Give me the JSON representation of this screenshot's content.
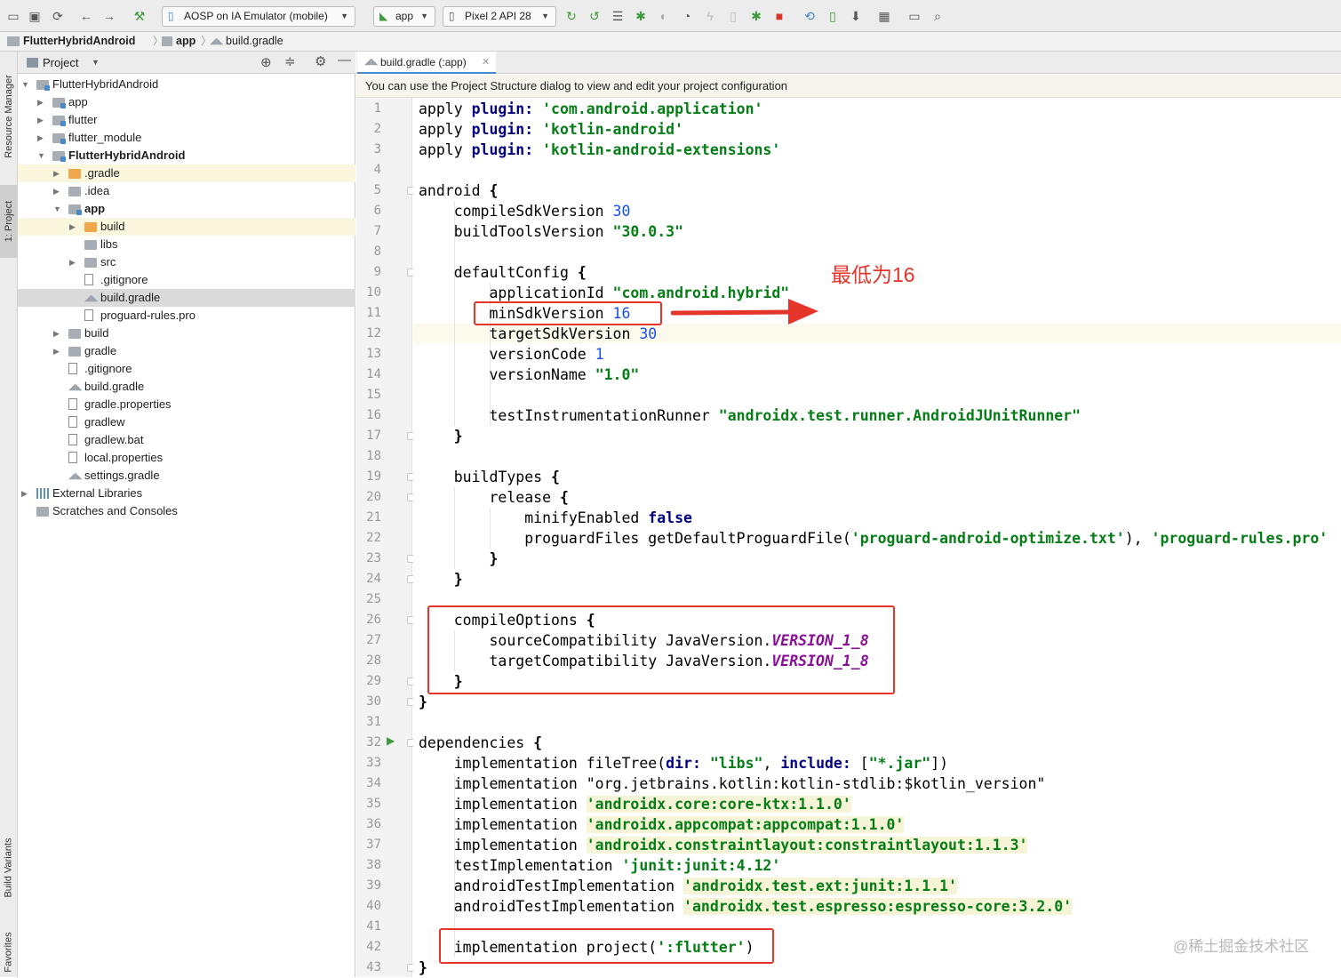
{
  "toolbar": {
    "config_label": "AOSP on IA Emulator (mobile)",
    "module_label": "app",
    "device_label": "Pixel 2 API 28"
  },
  "breadcrumb": [
    "FlutterHybridAndroid",
    "app",
    "build.gradle"
  ],
  "side_tabs": {
    "resource_manager": "Resource Manager",
    "project": "1: Project",
    "build_variants": "Build Variants",
    "favorites": "Favorites"
  },
  "project_panel": {
    "title": "Project",
    "tree": [
      {
        "label": "FlutterHybridAndroid",
        "depth": 0,
        "icon": "folder-mod",
        "expanded": true,
        "bold": false
      },
      {
        "label": "app",
        "depth": 1,
        "icon": "folder-mod",
        "expanded": false,
        "bold": false
      },
      {
        "label": "flutter",
        "depth": 1,
        "icon": "folder-mod",
        "expanded": false,
        "bold": false
      },
      {
        "label": "flutter_module",
        "depth": 1,
        "icon": "folder-mod",
        "expanded": false,
        "bold": false
      },
      {
        "label": "FlutterHybridAndroid",
        "depth": 1,
        "icon": "folder-mod",
        "expanded": true,
        "bold": true
      },
      {
        "label": ".gradle",
        "depth": 2,
        "icon": "folder-orange",
        "expanded": false,
        "bold": false,
        "highlight": "yellow"
      },
      {
        "label": ".idea",
        "depth": 2,
        "icon": "folder",
        "expanded": false,
        "bold": false
      },
      {
        "label": "app",
        "depth": 2,
        "icon": "folder-mod",
        "expanded": true,
        "bold": true
      },
      {
        "label": "build",
        "depth": 3,
        "icon": "folder-orange",
        "expanded": false,
        "bold": false,
        "highlight": "yellow"
      },
      {
        "label": "libs",
        "depth": 3,
        "icon": "folder",
        "leaf": true,
        "bold": false
      },
      {
        "label": "src",
        "depth": 3,
        "icon": "folder",
        "expanded": false,
        "bold": false
      },
      {
        "label": ".gitignore",
        "depth": 3,
        "icon": "file",
        "leaf": true,
        "bold": false
      },
      {
        "label": "build.gradle",
        "depth": 3,
        "icon": "gradle",
        "leaf": true,
        "bold": false,
        "highlight": "selected"
      },
      {
        "label": "proguard-rules.pro",
        "depth": 3,
        "icon": "file",
        "leaf": true,
        "bold": false
      },
      {
        "label": "build",
        "depth": 2,
        "icon": "folder",
        "expanded": false,
        "bold": false
      },
      {
        "label": "gradle",
        "depth": 2,
        "icon": "folder",
        "expanded": false,
        "bold": false
      },
      {
        "label": ".gitignore",
        "depth": 2,
        "icon": "file",
        "leaf": true,
        "bold": false
      },
      {
        "label": "build.gradle",
        "depth": 2,
        "icon": "gradle",
        "leaf": true,
        "bold": false
      },
      {
        "label": "gradle.properties",
        "depth": 2,
        "icon": "file",
        "leaf": true,
        "bold": false
      },
      {
        "label": "gradlew",
        "depth": 2,
        "icon": "file",
        "leaf": true,
        "bold": false
      },
      {
        "label": "gradlew.bat",
        "depth": 2,
        "icon": "file",
        "leaf": true,
        "bold": false
      },
      {
        "label": "local.properties",
        "depth": 2,
        "icon": "file",
        "leaf": true,
        "bold": false
      },
      {
        "label": "settings.gradle",
        "depth": 2,
        "icon": "gradle",
        "leaf": true,
        "bold": false
      },
      {
        "label": "External Libraries",
        "depth": 0,
        "icon": "lib",
        "expanded": false,
        "bold": false
      },
      {
        "label": "Scratches and Consoles",
        "depth": 0,
        "icon": "folder",
        "leaf": true,
        "bold": false
      }
    ]
  },
  "editor": {
    "tab_label": "build.gradle (:app)",
    "notice": "You can use the Project Structure dialog to view and edit your project configuration",
    "lines": [
      [
        [
          "apply ",
          ""
        ],
        [
          "plugin:",
          "kw"
        ],
        [
          " 'com.android.application'",
          "str"
        ]
      ],
      [
        [
          "apply ",
          ""
        ],
        [
          "plugin:",
          "kw"
        ],
        [
          " 'kotlin-android'",
          "str"
        ]
      ],
      [
        [
          "apply ",
          ""
        ],
        [
          "plugin:",
          "kw"
        ],
        [
          " 'kotlin-android-extensions'",
          "str"
        ]
      ],
      [],
      [
        [
          "android ",
          ""
        ],
        [
          "{",
          "bold"
        ]
      ],
      [
        [
          "    compileSdkVersion ",
          ""
        ],
        [
          "30",
          "num"
        ]
      ],
      [
        [
          "    buildToolsVersion ",
          ""
        ],
        [
          "\"30.0.3\"",
          "str"
        ]
      ],
      [],
      [
        [
          "    defaultConfig ",
          ""
        ],
        [
          "{",
          "bold"
        ]
      ],
      [
        [
          "        applicationId ",
          ""
        ],
        [
          "\"com.android.hybrid\"",
          "str"
        ]
      ],
      [
        [
          "        minSdkVersion ",
          ""
        ],
        [
          "16",
          "num"
        ]
      ],
      [
        [
          "        targetSdkVersion ",
          ""
        ],
        [
          "30",
          "num"
        ]
      ],
      [
        [
          "        versionCode ",
          ""
        ],
        [
          "1",
          "num"
        ]
      ],
      [
        [
          "        versionName ",
          ""
        ],
        [
          "\"1.0\"",
          "str"
        ]
      ],
      [],
      [
        [
          "        testInstrumentationRunner ",
          ""
        ],
        [
          "\"androidx.test.runner.AndroidJUnitRunner\"",
          "str"
        ]
      ],
      [
        [
          "    ",
          ""
        ],
        [
          "}",
          "bold"
        ]
      ],
      [],
      [
        [
          "    buildTypes ",
          ""
        ],
        [
          "{",
          "bold"
        ]
      ],
      [
        [
          "        release ",
          ""
        ],
        [
          "{",
          "bold"
        ]
      ],
      [
        [
          "            minifyEnabled ",
          ""
        ],
        [
          "false",
          "kw"
        ]
      ],
      [
        [
          "            proguardFiles getDefaultProguardFile(",
          ""
        ],
        [
          "'proguard-android-optimize.txt'",
          "str"
        ],
        [
          "), ",
          ""
        ],
        [
          "'proguard-rules.pro'",
          "str"
        ]
      ],
      [
        [
          "        ",
          ""
        ],
        [
          "}",
          "bold"
        ]
      ],
      [
        [
          "    ",
          ""
        ],
        [
          "}",
          "bold"
        ]
      ],
      [],
      [
        [
          "    compileOptions ",
          ""
        ],
        [
          "{",
          "bold"
        ]
      ],
      [
        [
          "        sourceCompatibility JavaVersion.",
          ""
        ],
        [
          "VERSION_1_8",
          "ital"
        ]
      ],
      [
        [
          "        targetCompatibility JavaVersion.",
          ""
        ],
        [
          "VERSION_1_8",
          "ital"
        ]
      ],
      [
        [
          "    ",
          ""
        ],
        [
          "}",
          "bold"
        ]
      ],
      [
        [
          "}",
          "bold"
        ]
      ],
      [],
      [
        [
          "dependencies ",
          ""
        ],
        [
          "{",
          "bold"
        ]
      ],
      [
        [
          "    implementation fileTree(",
          ""
        ],
        [
          "dir:",
          "kw"
        ],
        [
          " ",
          ""
        ],
        [
          "\"libs\"",
          "str"
        ],
        [
          ", ",
          ""
        ],
        [
          "include:",
          "kw"
        ],
        [
          " [",
          ""
        ],
        [
          "\"*.jar\"",
          "str"
        ],
        [
          "])",
          ""
        ]
      ],
      [
        [
          "    implementation ",
          ""
        ],
        [
          "\"org.jetbrains.kotlin:kotlin-stdlib:",
          ""
        ],
        [
          "$kotlin_version",
          ""
        ],
        [
          "\"",
          ""
        ]
      ],
      [
        [
          "    implementation ",
          ""
        ],
        [
          "'androidx.core:core-ktx:1.1.0'",
          "strhl"
        ]
      ],
      [
        [
          "    implementation ",
          ""
        ],
        [
          "'androidx.appcompat:appcompat:1.1.0'",
          "strhl"
        ]
      ],
      [
        [
          "    implementation ",
          ""
        ],
        [
          "'androidx.constraintlayout:constraintlayout:1.1.3'",
          "strhl"
        ]
      ],
      [
        [
          "    testImplementation ",
          ""
        ],
        [
          "'junit:junit:4.12'",
          "str"
        ]
      ],
      [
        [
          "    androidTestImplementation ",
          ""
        ],
        [
          "'androidx.test.ext:junit:1.1.1'",
          "strhl"
        ]
      ],
      [
        [
          "    androidTestImplementation ",
          ""
        ],
        [
          "'androidx.test.espresso:espresso-core:3.2.0'",
          "strhl"
        ]
      ],
      [],
      [
        [
          "    implementation project(",
          ""
        ],
        [
          "':flutter'",
          "str"
        ],
        [
          ")",
          ""
        ]
      ],
      [
        [
          "}",
          "bold"
        ]
      ]
    ]
  },
  "annotation": "最低为16",
  "watermark": "@稀土掘金技术社区",
  "colors": {
    "accent": "#e5352a",
    "string": "#067d17",
    "keyword": "#000080",
    "number": "#1750eb",
    "constant": "#871094"
  }
}
